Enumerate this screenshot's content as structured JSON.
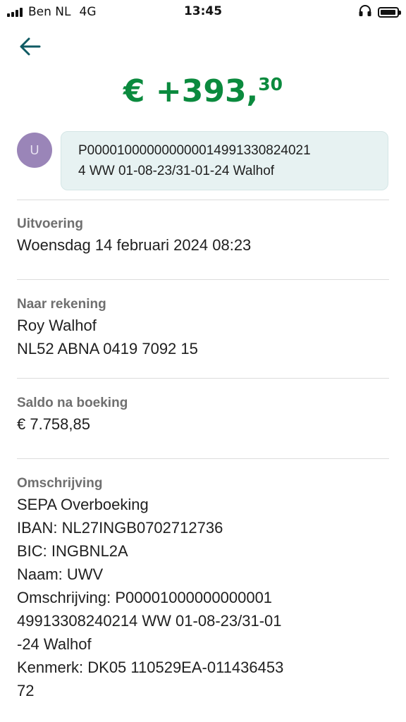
{
  "status_bar": {
    "carrier": "Ben NL",
    "network": "4G",
    "time": "13:45",
    "battery_level": 0.95,
    "icons": [
      "signal-icon",
      "headphones-icon",
      "battery-icon"
    ]
  },
  "header": {
    "back_icon": "arrow-left-icon"
  },
  "transaction": {
    "amount_main": "€ +393,",
    "amount_cents": "30",
    "amount_color": "#0b8a3e",
    "avatar_initial": "U",
    "avatar_color": "#9a85b8",
    "message": "P000010000000000014991330824021\n4 WW 01-08-23/31-01-24 Walhof"
  },
  "details": {
    "uitvoering": {
      "label": "Uitvoering",
      "value": "Woensdag 14 februari 2024 08:23"
    },
    "naar_rekening": {
      "label": "Naar rekening",
      "name": "Roy Walhof",
      "iban": "NL52 ABNA 0419 7092 15"
    },
    "saldo": {
      "label": "Saldo na boeking",
      "value": "€ 7.758,85"
    },
    "omschrijving": {
      "label": "Omschrijving",
      "lines": [
        "SEPA Overboeking",
        "IBAN: NL27INGB0702712736",
        "BIC: INGBNL2A",
        "Naam: UWV",
        "Omschrijving: P00001000000000001",
        "49913308240214 WW 01-08-23/31-01",
        "-24 Walhof",
        "Kenmerk: DK05 110529EA-011436453",
        "72"
      ]
    }
  }
}
